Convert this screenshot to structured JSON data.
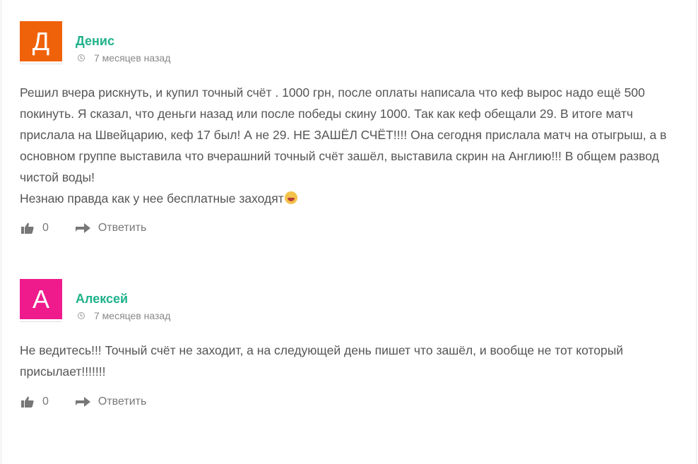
{
  "comments": [
    {
      "avatar_letter": "Д",
      "avatar_color": "#f0620a",
      "author": "Денис",
      "time": "7 месяцев назад",
      "text_lines": [
        "Решил вчера рискнуть, и купил точный счёт . 1000 грн, после оплаты написала что кеф вырос надо ещё 500 покинуть. Я сказал, что деньги назад или после победы скину 1000. Так как кеф обещали 29. В итоге матч прислала на Швейцарию, кеф 17 был! А не 29. НЕ ЗАШЁЛ СЧЁТ!!!! Она сегодня прислала матч на отыгрыш, а в основном группе выставила что вчерашний точный счёт зашёл, выставила скрин на Англию!!! В общем развод чистой воды!",
        "Незнаю правда как у нее бесплатные заходят"
      ],
      "emoji": "laughing-face-emoji",
      "likes": "0",
      "reply_label": "Ответить"
    },
    {
      "avatar_letter": "А",
      "avatar_color": "#ef1b8c",
      "author": "Алексей",
      "time": "7 месяцев назад",
      "text_lines": [
        "Не ведитесь!!! Точный счёт не заходит, а на следующей день пишет что зашёл, и вообще не тот который присылает!!!!!!!"
      ],
      "likes": "0",
      "reply_label": "Ответить"
    }
  ]
}
